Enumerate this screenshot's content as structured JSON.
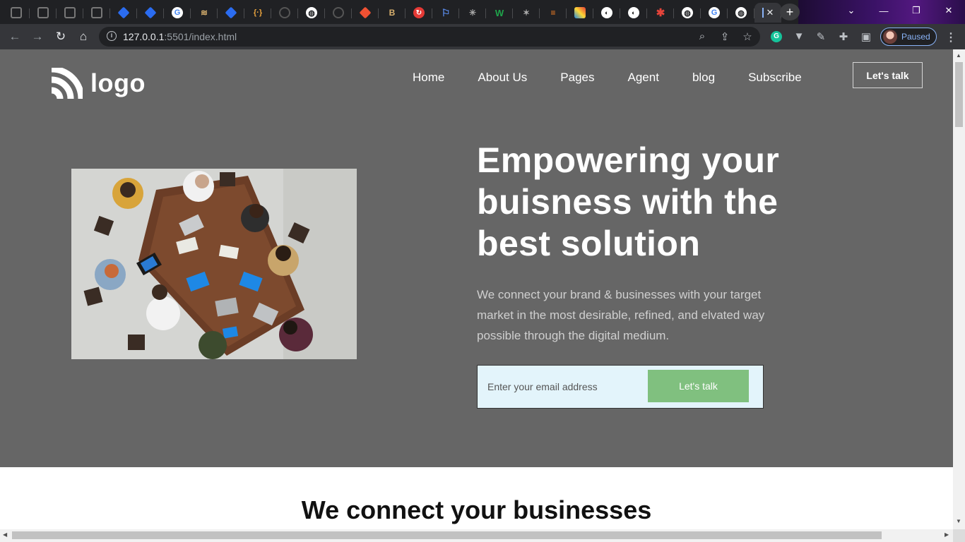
{
  "browser": {
    "tabs": [
      {
        "icon": "square-icon",
        "glyph": ""
      },
      {
        "icon": "square-icon",
        "glyph": ""
      },
      {
        "icon": "square-icon",
        "glyph": ""
      },
      {
        "icon": "square-icon",
        "glyph": ""
      },
      {
        "icon": "jira-icon",
        "glyph": ""
      },
      {
        "icon": "jira-icon",
        "glyph": ""
      },
      {
        "icon": "google-icon",
        "glyph": "G"
      },
      {
        "icon": "layers-icon",
        "glyph": "≋"
      },
      {
        "icon": "jira-icon",
        "glyph": ""
      },
      {
        "icon": "braces-icon",
        "glyph": "{·}"
      },
      {
        "icon": "github-icon",
        "glyph": ""
      },
      {
        "icon": "globe-icon",
        "glyph": "◍"
      },
      {
        "icon": "loading-icon",
        "glyph": ""
      },
      {
        "icon": "git-icon",
        "glyph": ""
      },
      {
        "icon": "bootstrap-icon",
        "glyph": "B"
      },
      {
        "icon": "red-circle-icon",
        "glyph": "↻"
      },
      {
        "icon": "flag-icon",
        "glyph": "⚐"
      },
      {
        "icon": "pulse-icon",
        "glyph": "✳"
      },
      {
        "icon": "w-icon",
        "glyph": "W"
      },
      {
        "icon": "sparkle-icon",
        "glyph": "✶"
      },
      {
        "icon": "stackoverflow-icon",
        "glyph": "≡"
      },
      {
        "icon": "multicolor-icon",
        "glyph": ""
      },
      {
        "icon": "planet-icon",
        "glyph": "◐"
      },
      {
        "icon": "planet-icon",
        "glyph": "◐"
      },
      {
        "icon": "asterisk-icon",
        "glyph": "✱"
      },
      {
        "icon": "globe-icon",
        "glyph": "◍"
      },
      {
        "icon": "google-icon",
        "glyph": "G"
      },
      {
        "icon": "globe-icon",
        "glyph": "◍"
      }
    ],
    "active_tab_close": "✕",
    "new_tab": "+",
    "url_host": "127.0.0.1",
    "url_rest": ":5501/index.html",
    "profile_status": "Paused"
  },
  "site": {
    "logo_text": "logo",
    "nav": [
      "Home",
      "About Us",
      "Pages",
      "Agent",
      "blog",
      "Subscribe"
    ],
    "cta_top": "Let's talk",
    "hero": {
      "headline": "Empowering your buisness with the best solution",
      "subtext": "We connect your brand & businesses with your target market in the most desirable, refined, and elvated way possible through the digital medium.",
      "email_placeholder": "Enter your email address",
      "submit_label": "Let's talk"
    },
    "section_title": "We connect your businesses"
  },
  "colors": {
    "hero_bg": "#666666",
    "submit_bg": "#80c07f",
    "form_bg": "#e3f4fb",
    "profile_accent": "#8ab4f8"
  }
}
